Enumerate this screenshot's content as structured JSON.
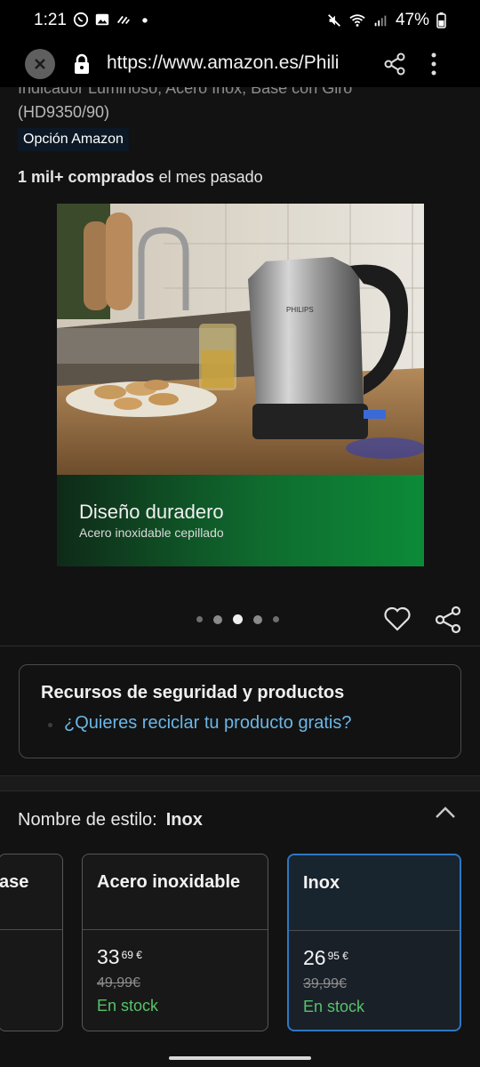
{
  "status_bar": {
    "time": "1:21",
    "battery": "47%"
  },
  "url_bar": {
    "url": "https://www.amazon.es/Phili"
  },
  "product": {
    "title_line1": "Indicador Luminoso, Acero Inox, Base con Giro",
    "title_line2": "(HD9350/90)",
    "badge": "Opción Amazon",
    "bought_bold": "1 mil+ comprados",
    "bought_rest": " el mes pasado"
  },
  "hero": {
    "caption_title": "Diseño duradero",
    "caption_sub": "Acero inoxidable cepillado",
    "brand": "PHILIPS",
    "slide_count": 5,
    "active_slide": 3
  },
  "safety": {
    "title": "Recursos de seguridad y productos",
    "link": "¿Quieres reciclar tu producto gratis?"
  },
  "style": {
    "label": "Nombre de estilo:",
    "value": "Inox",
    "options": [
      {
        "name": "ase"
      },
      {
        "name": "Acero inoxidable",
        "price_whole": "33",
        "price_frac": "69 €",
        "old_price": "49,99€",
        "stock": "En stock"
      },
      {
        "name": "Inox",
        "price_whole": "26",
        "price_frac": "95 €",
        "old_price": "39,99€",
        "stock": "En stock",
        "selected": true
      }
    ]
  },
  "colors": {
    "link": "#6cb6e6",
    "in_stock": "#58c26b",
    "selected_border": "#2f77c2"
  }
}
